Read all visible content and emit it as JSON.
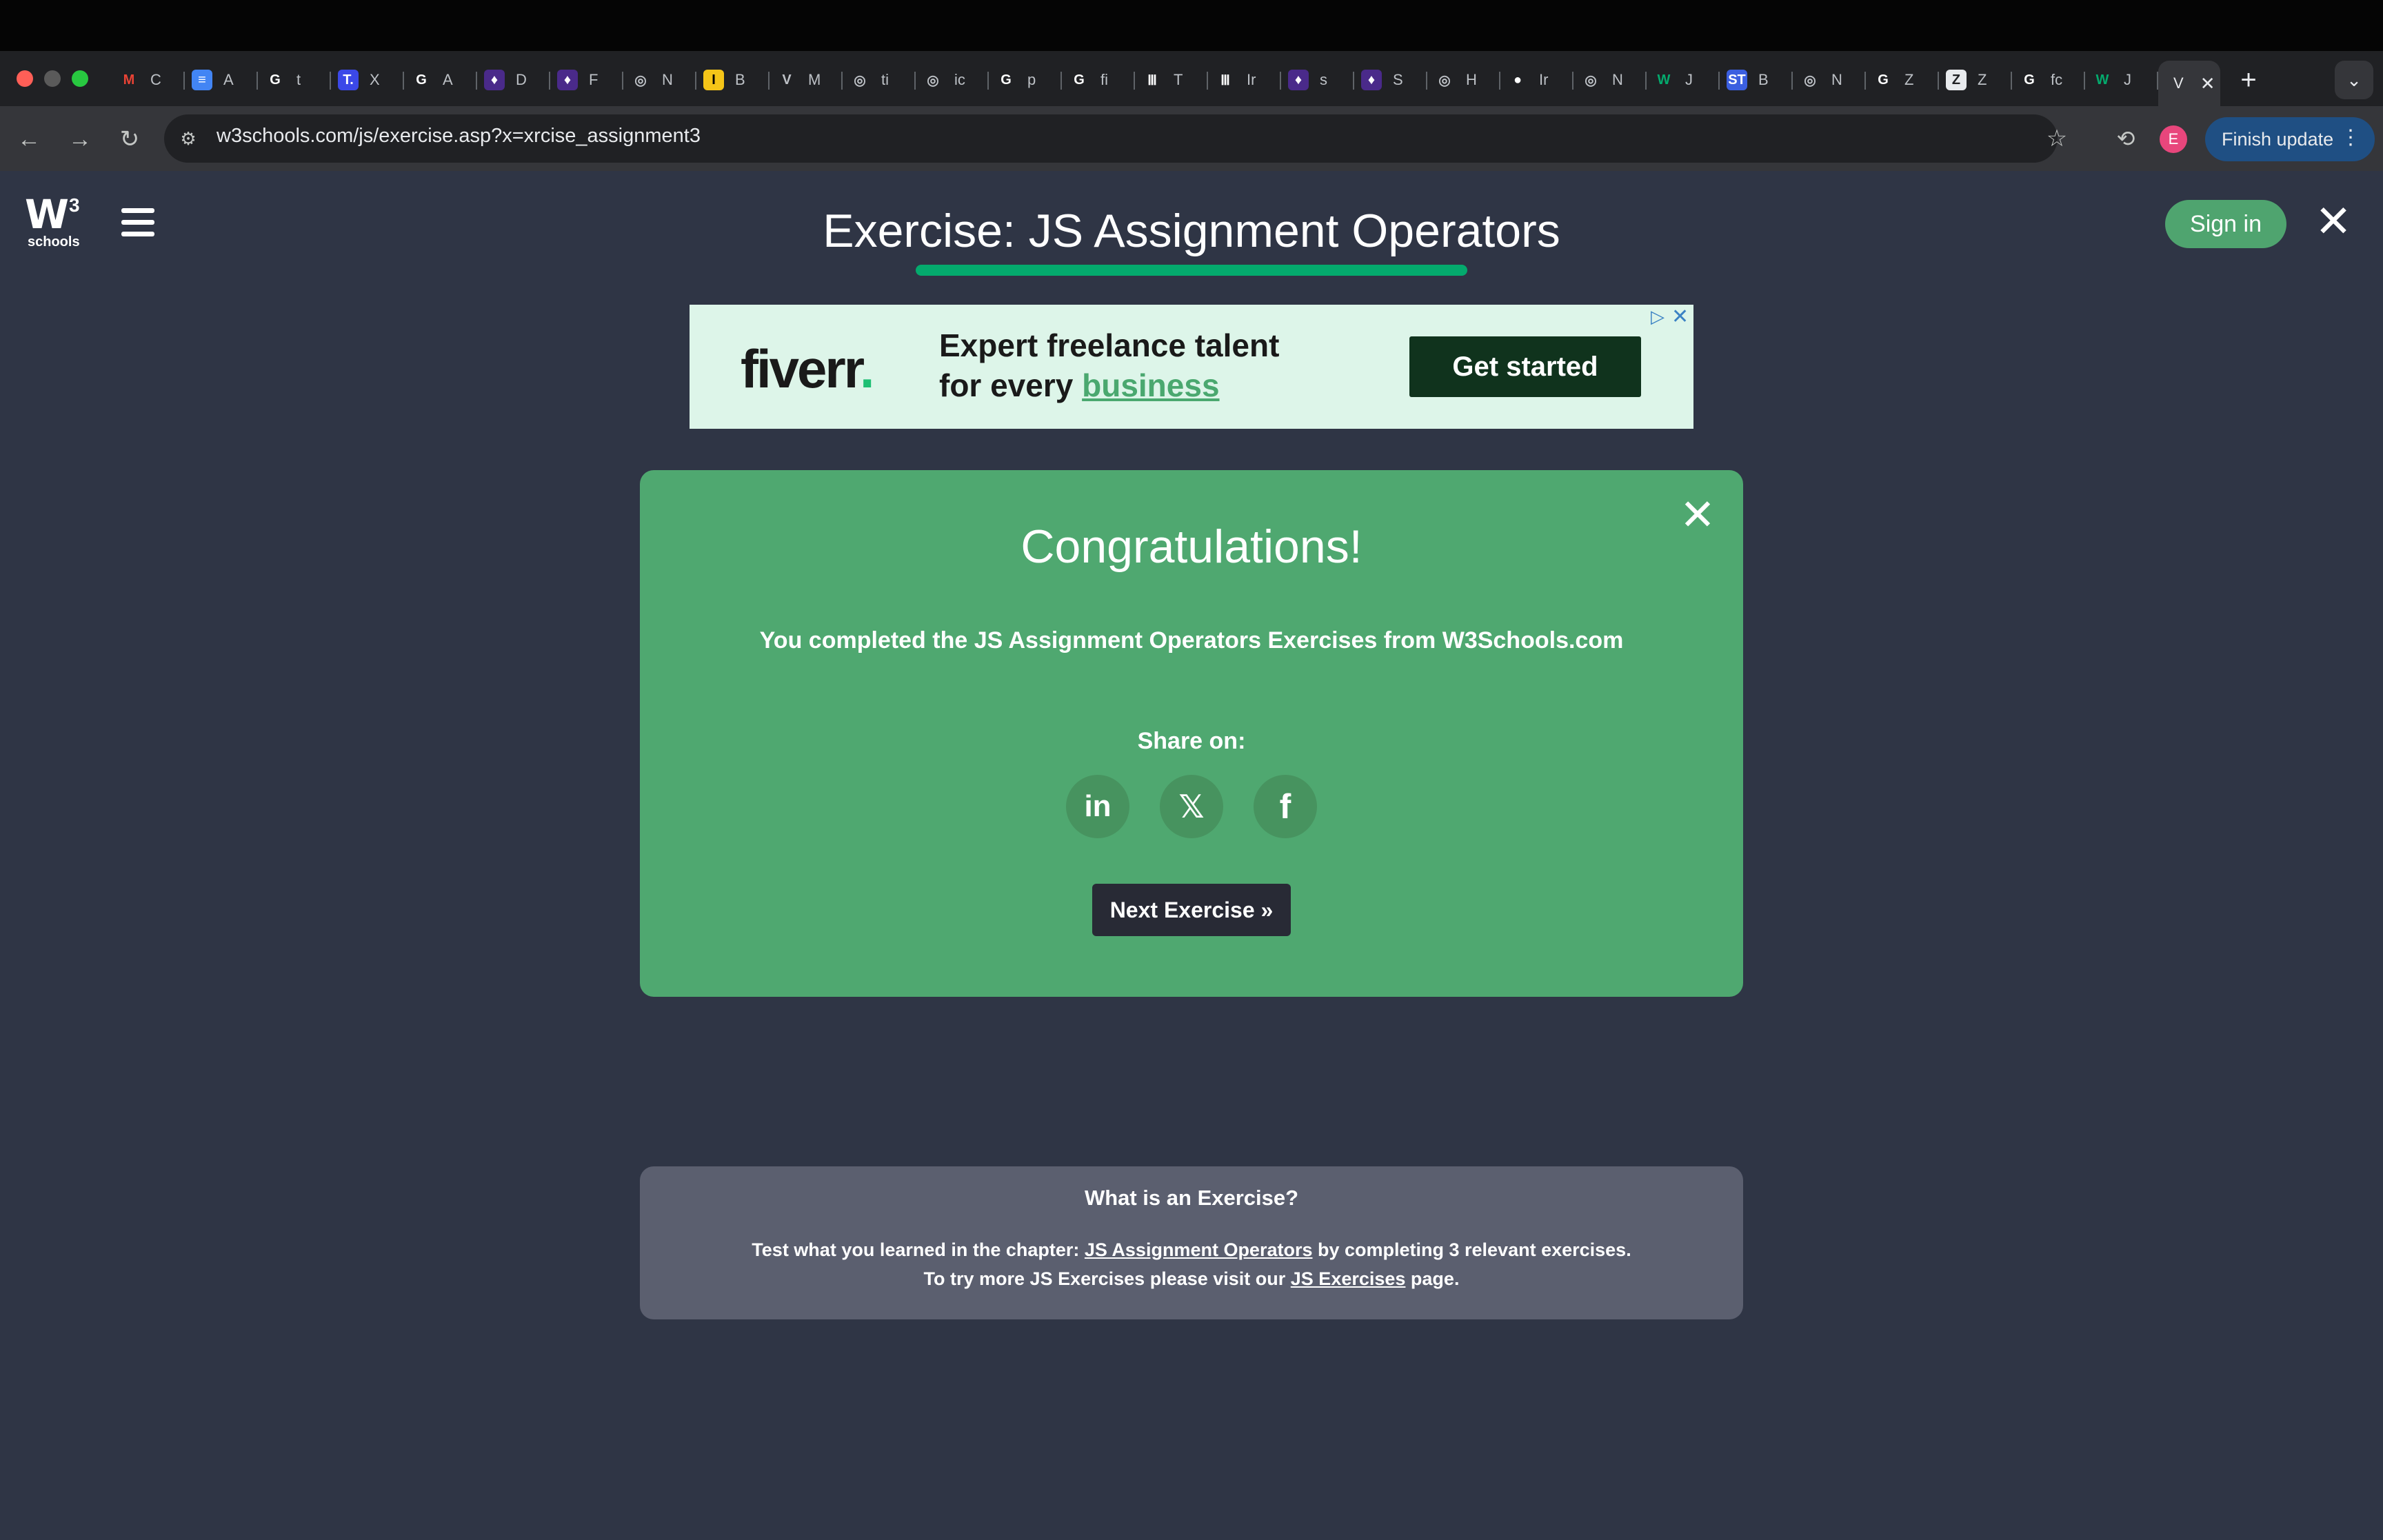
{
  "browser": {
    "tabs": [
      {
        "icon": "gmail-icon",
        "letter": "M",
        "color": "#ea4335",
        "bg": "transparent",
        "title": "C"
      },
      {
        "icon": "docs-icon",
        "letter": "≡",
        "color": "#ffffff",
        "bg": "#4285f4",
        "title": "A"
      },
      {
        "icon": "google-icon",
        "letter": "G",
        "color": "#ffffff",
        "bg": "transparent",
        "title": "t"
      },
      {
        "icon": "tab-t-icon",
        "letter": "T.",
        "color": "#ffffff",
        "bg": "#3b48e8",
        "title": "X"
      },
      {
        "icon": "google-icon",
        "letter": "G",
        "color": "#ffffff",
        "bg": "transparent",
        "title": "A"
      },
      {
        "icon": "purple-app-icon",
        "letter": "♦",
        "color": "#ffffff",
        "bg": "#4a2a8a",
        "title": "D"
      },
      {
        "icon": "purple-app-icon",
        "letter": "♦",
        "color": "#ffffff",
        "bg": "#4a2a8a",
        "title": "F"
      },
      {
        "icon": "globe-icon",
        "letter": "◎",
        "color": "#bdc1c6",
        "bg": "transparent",
        "title": "N"
      },
      {
        "icon": "yellow-i-icon",
        "letter": "I",
        "color": "#000000",
        "bg": "#f5c518",
        "title": "B"
      },
      {
        "icon": "v-logo-icon",
        "letter": "V",
        "color": "#bdc1c6",
        "bg": "transparent",
        "title": "M"
      },
      {
        "icon": "globe-icon",
        "letter": "◎",
        "color": "#bdc1c6",
        "bg": "transparent",
        "title": "ti"
      },
      {
        "icon": "globe-icon",
        "letter": "◎",
        "color": "#bdc1c6",
        "bg": "transparent",
        "title": "ic"
      },
      {
        "icon": "google-icon",
        "letter": "G",
        "color": "#ffffff",
        "bg": "transparent",
        "title": "p"
      },
      {
        "icon": "google-icon",
        "letter": "G",
        "color": "#ffffff",
        "bg": "transparent",
        "title": "fi"
      },
      {
        "icon": "library-icon",
        "letter": "Ⅲ",
        "color": "#ffffff",
        "bg": "transparent",
        "title": "T"
      },
      {
        "icon": "library-icon",
        "letter": "Ⅲ",
        "color": "#ffffff",
        "bg": "transparent",
        "title": "Ir"
      },
      {
        "icon": "purple-app-icon",
        "letter": "♦",
        "color": "#ffffff",
        "bg": "#4a2a8a",
        "title": "s"
      },
      {
        "icon": "purple-app-icon",
        "letter": "♦",
        "color": "#ffffff",
        "bg": "#4a2a8a",
        "title": "S"
      },
      {
        "icon": "globe-icon",
        "letter": "◎",
        "color": "#bdc1c6",
        "bg": "transparent",
        "title": "H"
      },
      {
        "icon": "github-icon",
        "letter": "●",
        "color": "#ffffff",
        "bg": "transparent",
        "title": "Ir"
      },
      {
        "icon": "globe-icon",
        "letter": "◎",
        "color": "#bdc1c6",
        "bg": "transparent",
        "title": "N"
      },
      {
        "icon": "w3schools-icon",
        "letter": "W",
        "color": "#04aa6d",
        "bg": "transparent",
        "title": "J"
      },
      {
        "icon": "st-icon",
        "letter": "ST",
        "color": "#ffffff",
        "bg": "#3b5fe0",
        "title": "B"
      },
      {
        "icon": "globe-icon",
        "letter": "◎",
        "color": "#bdc1c6",
        "bg": "transparent",
        "title": "N"
      },
      {
        "icon": "google-icon",
        "letter": "G",
        "color": "#ffffff",
        "bg": "transparent",
        "title": "Z"
      },
      {
        "icon": "z-icon",
        "letter": "Z",
        "color": "#202124",
        "bg": "#e8eaed",
        "title": "Z"
      },
      {
        "icon": "google-icon",
        "letter": "G",
        "color": "#ffffff",
        "bg": "transparent",
        "title": "fc"
      },
      {
        "icon": "w3schools-icon",
        "letter": "W",
        "color": "#04aa6d",
        "bg": "transparent",
        "title": "J"
      }
    ],
    "active_tab": {
      "title": "V",
      "close": "✕"
    },
    "new_tab": "+",
    "tab_menu": "⌄",
    "url": "w3schools.com/js/exercise.asp?x=xrcise_assignment3",
    "profile_initial": "E",
    "finish_update": "Finish update"
  },
  "header": {
    "logo_mark": "W",
    "logo_super": "3",
    "logo_text": "schools",
    "title": "Exercise: JS Assignment Operators",
    "sign_in": "Sign in",
    "close": "✕"
  },
  "ad": {
    "brand": "fiverr",
    "brand_dot": ".",
    "line1": "Expert freelance talent",
    "line2_prefix": "for every ",
    "line2_highlight": "business",
    "cta": "Get started"
  },
  "congrats": {
    "title": "Congratulations!",
    "message": "You completed the JS Assignment Operators Exercises from W3Schools.com",
    "share_label": "Share on:",
    "share": [
      "in",
      "𝕏",
      "f"
    ],
    "next": "Next Exercise »",
    "close": "✕"
  },
  "info": {
    "title": "What is an Exercise?",
    "line1_prefix": "Test what you learned in the chapter: ",
    "line1_link": "JS Assignment Operators",
    "line1_suffix": " by completing 3 relevant exercises.",
    "line2_prefix": "To try more JS Exercises please visit our ",
    "line2_link": "JS Exercises",
    "line2_suffix": " page."
  },
  "colors": {
    "page_bg": "#2f3545",
    "accent_green": "#04aa6d",
    "card_green": "#4fa870",
    "button_dark": "#282a35"
  }
}
